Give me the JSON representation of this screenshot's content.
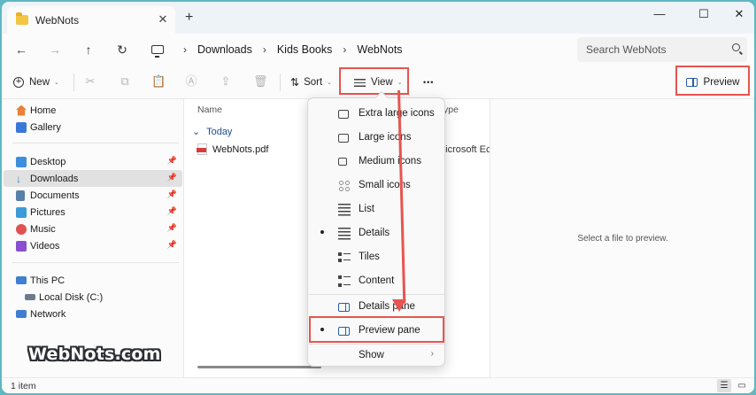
{
  "window": {
    "tab_title": "WebNots",
    "tab_close": "✕",
    "new_tab": "+",
    "controls": {
      "minimize": "—",
      "maximize": "☐",
      "close": "✕"
    }
  },
  "address": {
    "back": "←",
    "forward": "→",
    "up": "↑",
    "refresh": "↻",
    "crumbs": [
      "Downloads",
      "Kids Books",
      "WebNots"
    ],
    "separator": "›",
    "search_placeholder": "Search WebNots"
  },
  "toolbar": {
    "new_label": "New",
    "sort_label": "Sort",
    "view_label": "View",
    "more_label": "•••",
    "preview_label": "Preview",
    "caret": "⌄",
    "icons": [
      "cut-icon",
      "copy-icon",
      "paste-icon",
      "rename-icon",
      "share-icon",
      "delete-icon"
    ]
  },
  "sidebar": {
    "group1": [
      {
        "label": "Home",
        "color": "#e8823a"
      },
      {
        "label": "Gallery",
        "color": "#3a78d8"
      }
    ],
    "group2": [
      {
        "label": "Desktop",
        "color": "#3e8ede",
        "pinned": true
      },
      {
        "label": "Downloads",
        "color": "#2b8fd6",
        "pinned": true,
        "active": true
      },
      {
        "label": "Documents",
        "color": "#5a7fa8",
        "pinned": true
      },
      {
        "label": "Pictures",
        "color": "#3a9bd9",
        "pinned": true
      },
      {
        "label": "Music",
        "color": "#e0524f",
        "pinned": true
      },
      {
        "label": "Videos",
        "color": "#8a4fcf",
        "pinned": true
      }
    ],
    "group3": [
      {
        "label": "This PC",
        "color": "#3e7fd0"
      },
      {
        "label": "Local Disk (C:)",
        "color": "#6b7b8c"
      },
      {
        "label": "Network",
        "color": "#3e7fd0"
      }
    ],
    "pin_glyph": "📌"
  },
  "content": {
    "col_name": "Name",
    "col_type": "ype",
    "group": "Today",
    "group_arrow": "⌄",
    "file_name": "WebNots.pdf",
    "file_type": "Microsoft Ec"
  },
  "view_menu": {
    "items": [
      {
        "label": "Extra large icons"
      },
      {
        "label": "Large icons"
      },
      {
        "label": "Medium icons"
      },
      {
        "label": "Small icons"
      },
      {
        "label": "List"
      },
      {
        "label": "Details",
        "selected": true
      },
      {
        "label": "Tiles"
      },
      {
        "label": "Content"
      },
      {
        "label": "Details pane"
      },
      {
        "label": "Preview pane",
        "selected": true
      },
      {
        "label": "Show",
        "submenu": true
      }
    ],
    "submenu_arrow": "›"
  },
  "preview": {
    "message": "Select a file to preview."
  },
  "status": {
    "item_count": "1 item"
  },
  "watermark": "WebNots.com",
  "colors": {
    "highlight": "#e8544f",
    "accent": "#2a5ea8",
    "background": "#5fb8c2"
  }
}
